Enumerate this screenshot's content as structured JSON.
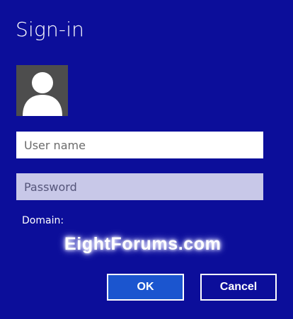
{
  "dialog": {
    "title": "Sign-in"
  },
  "avatar": {
    "icon": "user-silhouette-icon"
  },
  "fields": {
    "username": {
      "value": "",
      "placeholder": "User name"
    },
    "password": {
      "value": "",
      "placeholder": "Password"
    },
    "domain_label": "Domain:"
  },
  "watermark": "EightForums.com",
  "buttons": {
    "ok_label": "OK",
    "cancel_label": "Cancel"
  },
  "colors": {
    "background": "#0c0e9a",
    "ok_button": "#1b55cf",
    "avatar_bg": "#4d4d4d",
    "password_field": "#c8c8e8"
  }
}
